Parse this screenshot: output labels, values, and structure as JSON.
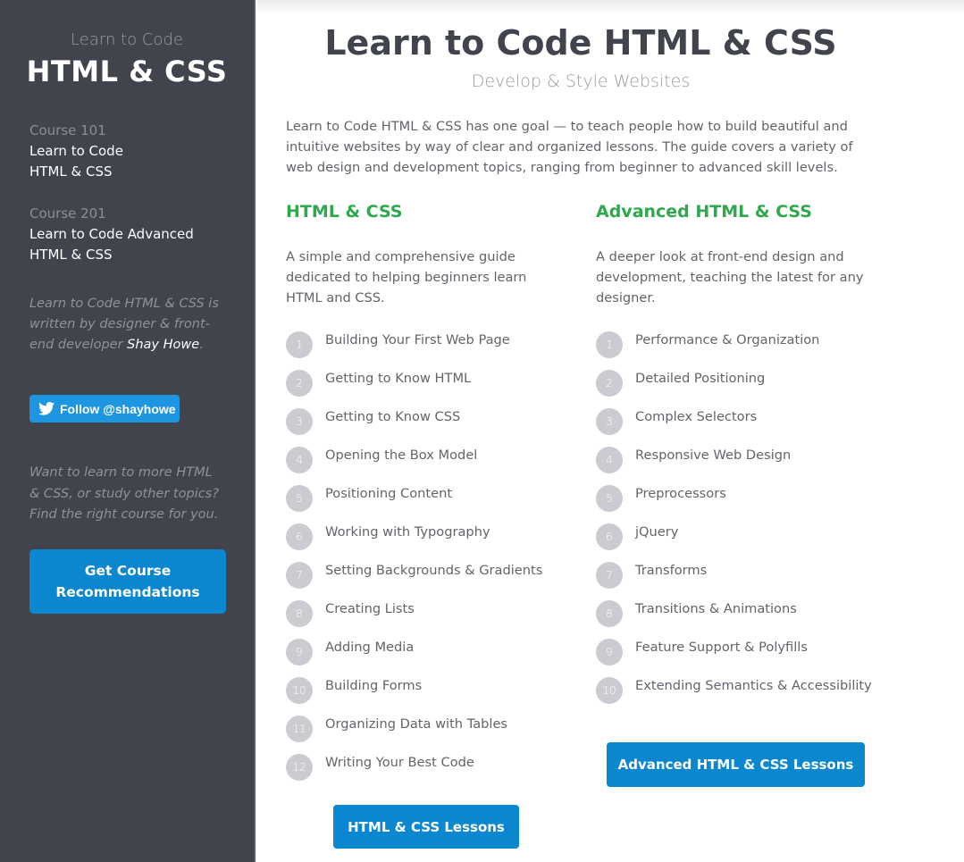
{
  "sidebar": {
    "brand_sub": "Learn to Code",
    "brand_main": "HTML & CSS",
    "courses": [
      {
        "number": "Course 101",
        "title_line1": "Learn to Code",
        "title_line2": "HTML & CSS"
      },
      {
        "number": "Course 201",
        "title_line1": "Learn to Code Advanced",
        "title_line2": "HTML & CSS"
      }
    ],
    "about_prefix": "Learn to Code HTML & CSS is written by designer & front-end developer ",
    "about_author": "Shay Howe",
    "about_suffix": ".",
    "twitter_label": "Follow @shayhowe",
    "want_text": "Want to learn to more HTML & CSS, or study other topics? Find the right course for you.",
    "recommend_button": "Get Course Recommendations"
  },
  "main": {
    "title": "Learn to Code HTML & CSS",
    "subtitle": "Develop & Style Websites",
    "intro": "Learn to Code HTML & CSS has one goal — to teach people how to build beautiful and intuitive websites by way of clear and organized lessons. The guide covers a variety of web design and development topics, ranging from beginner to advanced skill levels.",
    "basic": {
      "heading": "HTML & CSS",
      "description": "A simple and comprehensive guide dedicated to helping beginners learn HTML and CSS.",
      "lessons": [
        {
          "num": "1",
          "title": "Building Your First Web Page"
        },
        {
          "num": "2",
          "title": "Getting to Know HTML"
        },
        {
          "num": "3",
          "title": "Getting to Know CSS"
        },
        {
          "num": "4",
          "title": "Opening the Box Model"
        },
        {
          "num": "5",
          "title": "Positioning Content"
        },
        {
          "num": "6",
          "title": "Working with Typography"
        },
        {
          "num": "7",
          "title": "Setting Backgrounds & Gradients"
        },
        {
          "num": "8",
          "title": "Creating Lists"
        },
        {
          "num": "9",
          "title": "Adding Media"
        },
        {
          "num": "10",
          "title": "Building Forms"
        },
        {
          "num": "11",
          "title": "Organizing Data with Tables"
        },
        {
          "num": "12",
          "title": "Writing Your Best Code"
        }
      ],
      "button": "HTML & CSS Lessons"
    },
    "advanced": {
      "heading": "Advanced HTML & CSS",
      "description": "A deeper look at front-end design and development, teaching the latest for any designer.",
      "lessons": [
        {
          "num": "1",
          "title": "Performance & Organization"
        },
        {
          "num": "2",
          "title": "Detailed Positioning"
        },
        {
          "num": "3",
          "title": "Complex Selectors"
        },
        {
          "num": "4",
          "title": "Responsive Web Design"
        },
        {
          "num": "5",
          "title": "Preprocessors"
        },
        {
          "num": "6",
          "title": "jQuery"
        },
        {
          "num": "7",
          "title": "Transforms"
        },
        {
          "num": "8",
          "title": "Transitions & Animations"
        },
        {
          "num": "9",
          "title": "Feature Support & Polyfills"
        },
        {
          "num": "10",
          "title": "Extending Semantics & Accessibility"
        }
      ],
      "button": "Advanced HTML & CSS Lessons"
    }
  },
  "colors": {
    "sidebar_bg": "#41434d",
    "accent_green": "#2ea94d",
    "button_blue": "#0a87cf",
    "twitter_blue": "#1d95e0"
  }
}
